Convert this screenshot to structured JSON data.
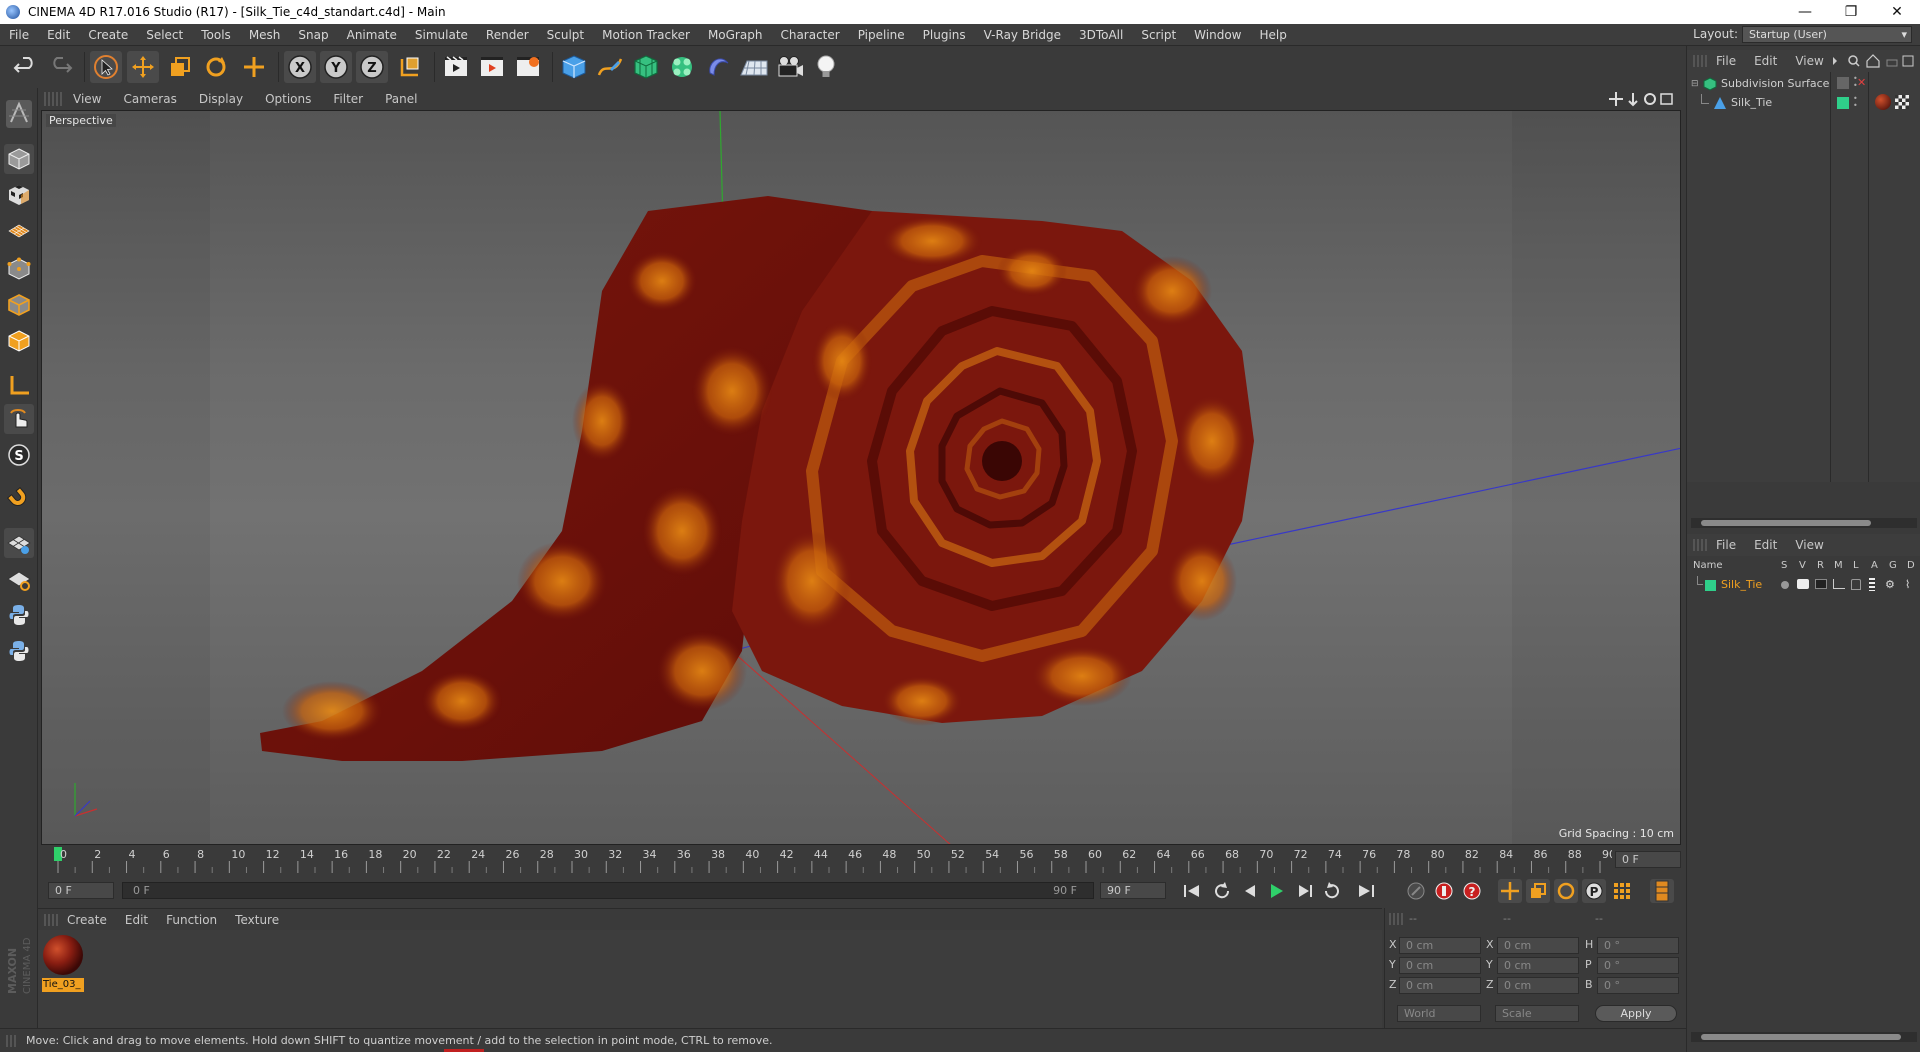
{
  "window": {
    "title": "CINEMA 4D R17.016 Studio (R17) - [Silk_Tie_c4d_standart.c4d] - Main",
    "minimize_glyph": "—",
    "restore_glyph": "❐",
    "close_glyph": "✕"
  },
  "menubar": {
    "items": [
      "File",
      "Edit",
      "Create",
      "Select",
      "Tools",
      "Mesh",
      "Snap",
      "Animate",
      "Simulate",
      "Render",
      "Sculpt",
      "Motion Tracker",
      "MoGraph",
      "Character",
      "Pipeline",
      "Plugins",
      "V-Ray Bridge",
      "3DToAll",
      "Script",
      "Window",
      "Help"
    ],
    "layout_label": "Layout:",
    "layout_value": "Startup (User)"
  },
  "toolbar": {
    "axis_x": "X",
    "axis_y": "Y",
    "axis_z": "Z"
  },
  "lefttools": {
    "sculpt_letter": "S"
  },
  "viewport": {
    "menu": [
      "View",
      "Cameras",
      "Display",
      "Options",
      "Filter",
      "Panel"
    ],
    "label": "Perspective",
    "grid_spacing": "Grid Spacing : 10 cm"
  },
  "timeline": {
    "ticks": [
      "0",
      "2",
      "4",
      "6",
      "8",
      "10",
      "12",
      "14",
      "16",
      "18",
      "20",
      "22",
      "24",
      "26",
      "28",
      "30",
      "32",
      "34",
      "36",
      "38",
      "40",
      "42",
      "44",
      "46",
      "48",
      "50",
      "52",
      "54",
      "56",
      "58",
      "60",
      "62",
      "64",
      "66",
      "68",
      "70",
      "72",
      "74",
      "76",
      "78",
      "80",
      "82",
      "84",
      "86",
      "88",
      "90"
    ],
    "current_frame": "0 F"
  },
  "playbar": {
    "start_field": "0 F",
    "range_start": "0 F",
    "range_end": "90 F",
    "end_field": "90 F"
  },
  "material_manager": {
    "menu": [
      "Create",
      "Edit",
      "Function",
      "Texture"
    ],
    "material_name": "Tie_03_"
  },
  "coordinates": {
    "headers": [
      "--",
      "--",
      "--"
    ],
    "rows": [
      {
        "pos_label": "X",
        "pos": "0 cm",
        "size_label": "X",
        "size": "0 cm",
        "rot_label": "H",
        "rot": "0 °"
      },
      {
        "pos_label": "Y",
        "pos": "0 cm",
        "size_label": "Y",
        "size": "0 cm",
        "rot_label": "P",
        "rot": "0 °"
      },
      {
        "pos_label": "Z",
        "pos": "0 cm",
        "size_label": "Z",
        "size": "0 cm",
        "rot_label": "B",
        "rot": "0 °"
      }
    ],
    "mode": "World",
    "size_mode": "Scale",
    "apply": "Apply"
  },
  "object_manager": {
    "menu": [
      "File",
      "Edit",
      "View"
    ],
    "objects": [
      {
        "name": "Subdivision Surface"
      },
      {
        "name": "Silk_Tie"
      }
    ]
  },
  "layer_manager": {
    "menu": [
      "File",
      "Edit",
      "View"
    ],
    "columns": [
      "Name",
      "S",
      "V",
      "R",
      "M",
      "L",
      "A",
      "G",
      "D"
    ],
    "rows": [
      {
        "name": "Silk_Tie"
      }
    ]
  },
  "status": {
    "text": "Move: Click and drag to move elements. Hold down SHIFT to quantize movement / add to the selection in point mode, CTRL to remove."
  },
  "branding": {
    "logo_text": "MAXON CINEMA 4D"
  },
  "colors": {
    "accent_blue": "#2f8cff",
    "layer_green": "#2fcf8a",
    "active_frame": "#2fd06a",
    "material": "#8a1e12",
    "tie_dark": "#6e0d0a",
    "tie_orange": "#d9780e"
  }
}
